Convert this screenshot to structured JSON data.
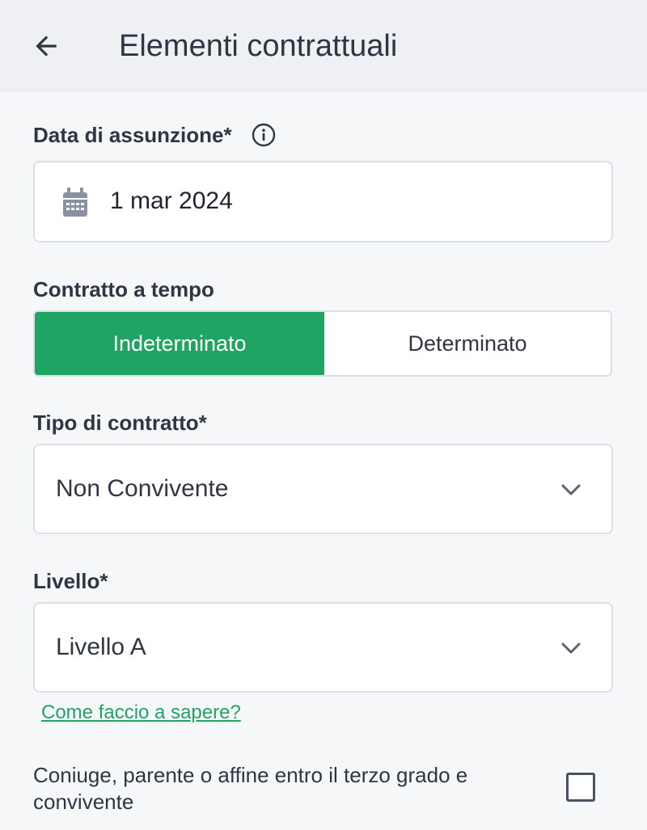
{
  "header": {
    "title": "Elementi contrattuali",
    "back_icon": "arrow-left-icon"
  },
  "hire_date": {
    "label": "Data di assunzione*",
    "info_icon": "info-icon",
    "calendar_icon": "calendar-icon",
    "value": "1 mar 2024"
  },
  "contract_duration": {
    "label": "Contratto a tempo",
    "options": [
      "Indeterminato",
      "Determinato"
    ],
    "selected": "Indeterminato",
    "active_color": "#1fa463"
  },
  "contract_type": {
    "label": "Tipo di contratto*",
    "value": "Non Convivente",
    "icon": "chevron-down-icon"
  },
  "level": {
    "label": "Livello*",
    "value": "Livello A",
    "icon": "chevron-down-icon",
    "help_link": "Come faccio a sapere?"
  },
  "relative_checkbox": {
    "label": "Coniuge, parente o affine entro il terzo grado e convivente",
    "checked": false
  }
}
